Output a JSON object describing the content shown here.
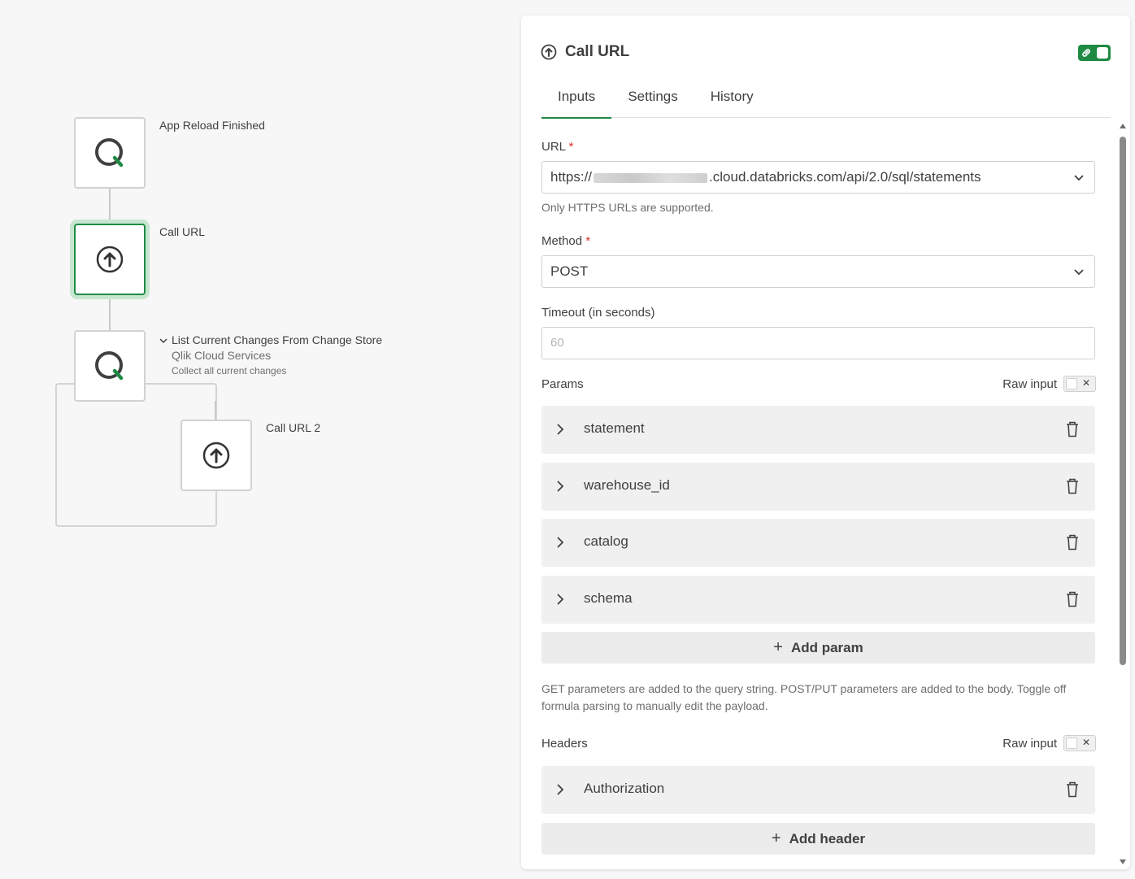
{
  "canvas": {
    "nodes": [
      {
        "title": "App Reload Finished",
        "icon": "qlik-q-icon"
      },
      {
        "title": "Call URL",
        "icon": "arrow-up-circle-icon"
      },
      {
        "title": "List Current Changes From Change Store",
        "subtitle": "Qlik Cloud Services",
        "description": "Collect all current changes",
        "icon": "qlik-q-icon"
      },
      {
        "title": "Call URL 2",
        "icon": "arrow-up-circle-icon"
      }
    ]
  },
  "panel": {
    "title": "Call URL",
    "icon": "arrow-up-circle-icon",
    "tabs": [
      "Inputs",
      "Settings",
      "History"
    ],
    "active_tab": "Inputs",
    "url": {
      "label": "URL",
      "required_mark": "*",
      "value_prefix": "https://",
      "value_suffix": ".cloud.databricks.com/api/2.0/sql/statements",
      "hint": "Only HTTPS URLs are supported."
    },
    "method": {
      "label": "Method",
      "required_mark": "*",
      "value": "POST"
    },
    "timeout": {
      "label": "Timeout (in seconds)",
      "placeholder": "60"
    },
    "params": {
      "label": "Params",
      "raw_input_label": "Raw input",
      "items": [
        "statement",
        "warehouse_id",
        "catalog",
        "schema"
      ],
      "add_label": "Add param",
      "note": "GET parameters are added to the query string. POST/PUT parameters are added to the body. Toggle off formula parsing to manually edit the payload."
    },
    "headers": {
      "label": "Headers",
      "raw_input_label": "Raw input",
      "items": [
        "Authorization"
      ],
      "add_label": "Add header"
    }
  },
  "colors": {
    "accent": "#1f8a44",
    "required": "#d6332a"
  }
}
